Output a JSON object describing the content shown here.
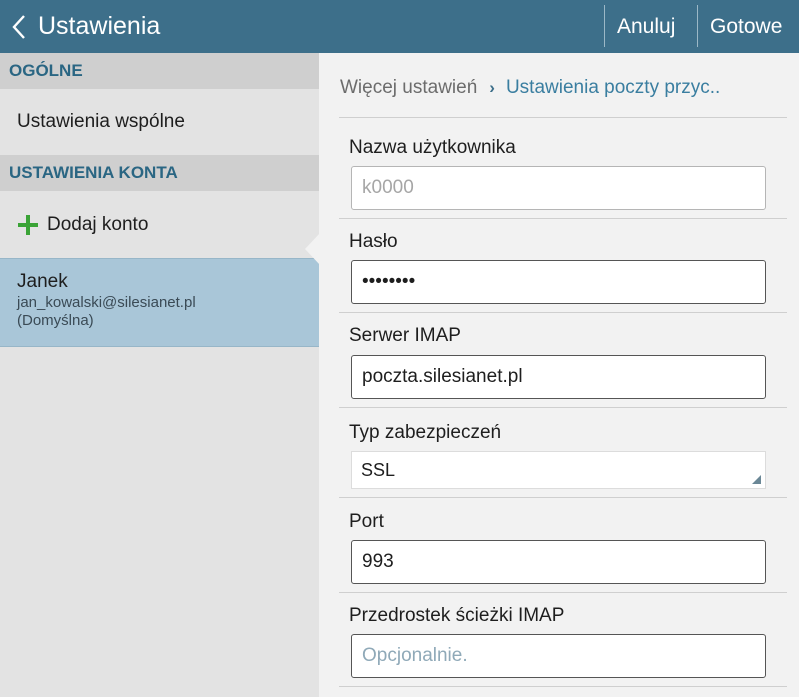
{
  "action_bar": {
    "title": "Ustawienia",
    "cancel_label": "Anuluj",
    "done_label": "Gotowe"
  },
  "sidebar": {
    "general_header": "OGÓLNE",
    "common_settings": "Ustawienia wspólne",
    "account_header": "USTAWIENIA KONTA",
    "add_account": "Dodaj konto",
    "account": {
      "name": "Janek",
      "email": "jan_kowalski@silesianet.pl",
      "default_label": "(Domyślna)"
    }
  },
  "breadcrumb": {
    "previous": "Więcej ustawień",
    "separator": "›",
    "current": "Ustawienia poczty przyc.."
  },
  "form": {
    "username": {
      "label": "Nazwa użytkownika",
      "value": "k0000"
    },
    "password": {
      "label": "Hasło",
      "value": "••••••••"
    },
    "imap_server": {
      "label": "Serwer IMAP",
      "value": "poczta.silesianet.pl"
    },
    "security_type": {
      "label": "Typ zabezpieczeń",
      "value": "SSL"
    },
    "port": {
      "label": "Port",
      "value": "993"
    },
    "imap_prefix": {
      "label": "Przedrostek ścieżki IMAP",
      "value": "",
      "placeholder": "Opcjonalnie."
    }
  },
  "colors": {
    "action_bar": "#3d6f8a",
    "section_header_text": "#2a6683",
    "selected_account": "#a9c6d8",
    "add_icon": "#3aa336"
  }
}
